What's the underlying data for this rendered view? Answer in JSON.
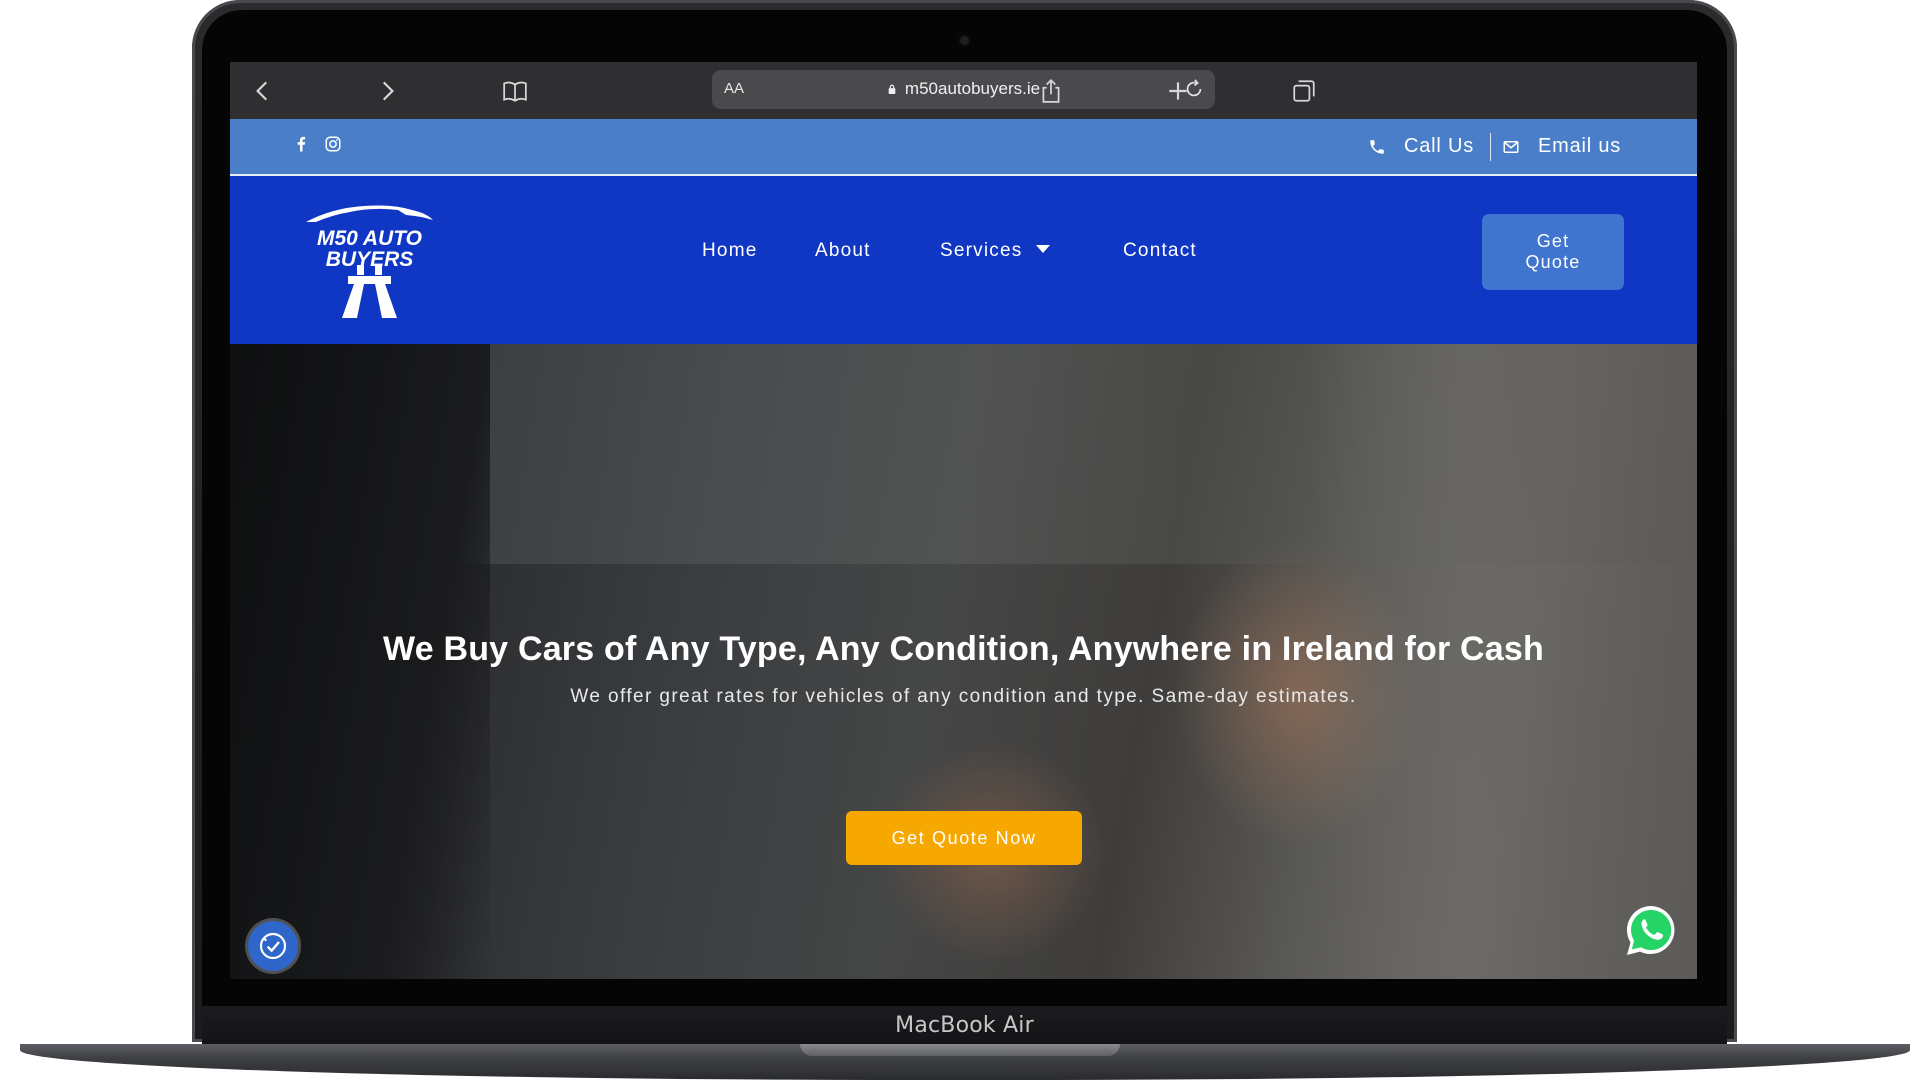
{
  "device": {
    "label": "MacBook Air"
  },
  "browser": {
    "text_size_label": "AA",
    "url": "m50autobuyers.ie",
    "icons": [
      "chevron-left-icon",
      "chevron-right-icon",
      "bookmarks-icon",
      "lock-icon",
      "reload-icon",
      "share-icon",
      "plus-icon",
      "tabs-icon"
    ]
  },
  "topbar": {
    "social_icons": [
      "facebook-icon",
      "instagram-icon"
    ],
    "call_label": "Call Us",
    "email_label": "Email us"
  },
  "logo": {
    "line1": "M50 AUTO",
    "line2": "BUYERS"
  },
  "nav": {
    "home": "Home",
    "about": "About",
    "services": "Services",
    "contact": "Contact",
    "quote_line1": "Get",
    "quote_line2": "Quote"
  },
  "hero": {
    "title": "We Buy Cars of Any Type, Any Condition, Anywhere in Ireland for Cash",
    "subtitle": "We offer great rates for vehicles of any condition and type. Same-day estimates.",
    "cta": "Get Quote Now"
  },
  "floating": {
    "accessibility_icon": "accessibility-icon",
    "whatsapp_icon": "whatsapp-icon"
  },
  "colors": {
    "topbar": "#4a7ec8",
    "navbar": "#1037c4",
    "quote_button": "#3f74cf",
    "cta_button": "#f6a800",
    "safari_toolbar": "#2f2f31"
  }
}
